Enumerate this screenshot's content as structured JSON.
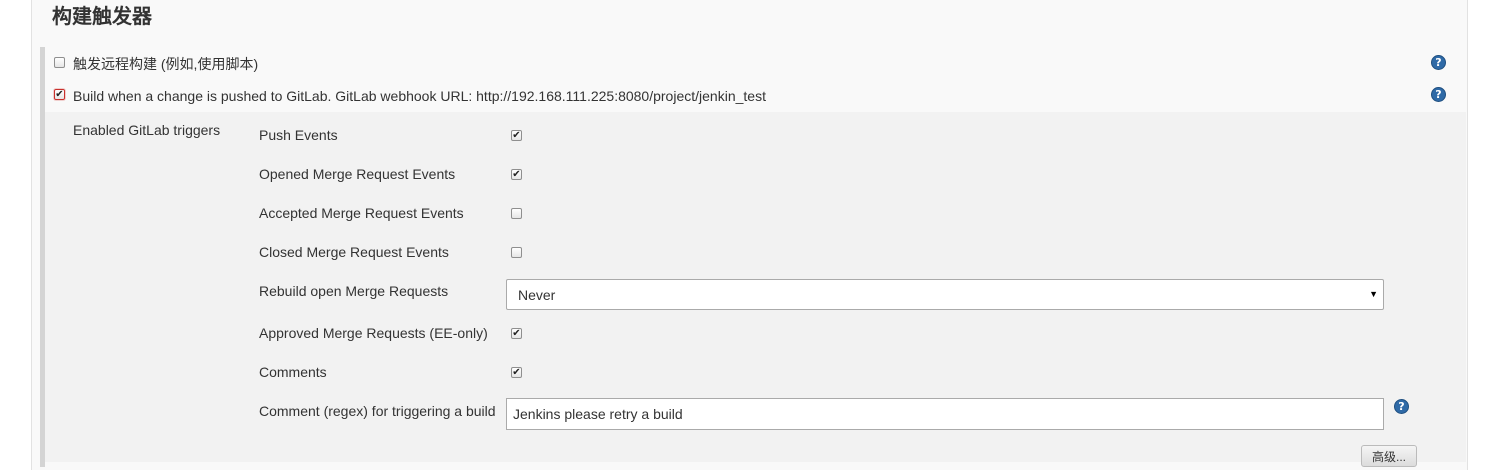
{
  "section": {
    "title": "构建触发器"
  },
  "triggers": {
    "remote": {
      "label": "触发远程构建 (例如,使用脚本)",
      "checked": false
    },
    "gitlab": {
      "label": "Build when a change is pushed to GitLab. GitLab webhook URL: http://192.168.111.225:8080/project/jenkin_test",
      "checked": true
    }
  },
  "gitlab_triggers": {
    "heading": "Enabled GitLab triggers",
    "push_events": {
      "label": "Push Events",
      "checked": true
    },
    "opened_mr": {
      "label": "Opened Merge Request Events",
      "checked": true
    },
    "accepted_mr": {
      "label": "Accepted Merge Request Events",
      "checked": false
    },
    "closed_mr": {
      "label": "Closed Merge Request Events",
      "checked": false
    },
    "rebuild": {
      "label": "Rebuild open Merge Requests",
      "value": "Never"
    },
    "approved_mr": {
      "label": "Approved Merge Requests (EE-only)",
      "checked": true
    },
    "comments": {
      "label": "Comments",
      "checked": true
    },
    "comment_regex": {
      "label": "Comment (regex) for triggering a build",
      "value": "Jenkins please retry a build"
    }
  },
  "advanced_button": {
    "label": "高级..."
  },
  "icons": {
    "help": "question-mark-circle-icon",
    "check": "checkmark-icon",
    "dropdown": "dropdown-arrow-icon"
  },
  "colors": {
    "help_blue": "#2f6aa7",
    "panel_bg": "#f9f9f9",
    "block_bg": "#f2f2f2"
  }
}
